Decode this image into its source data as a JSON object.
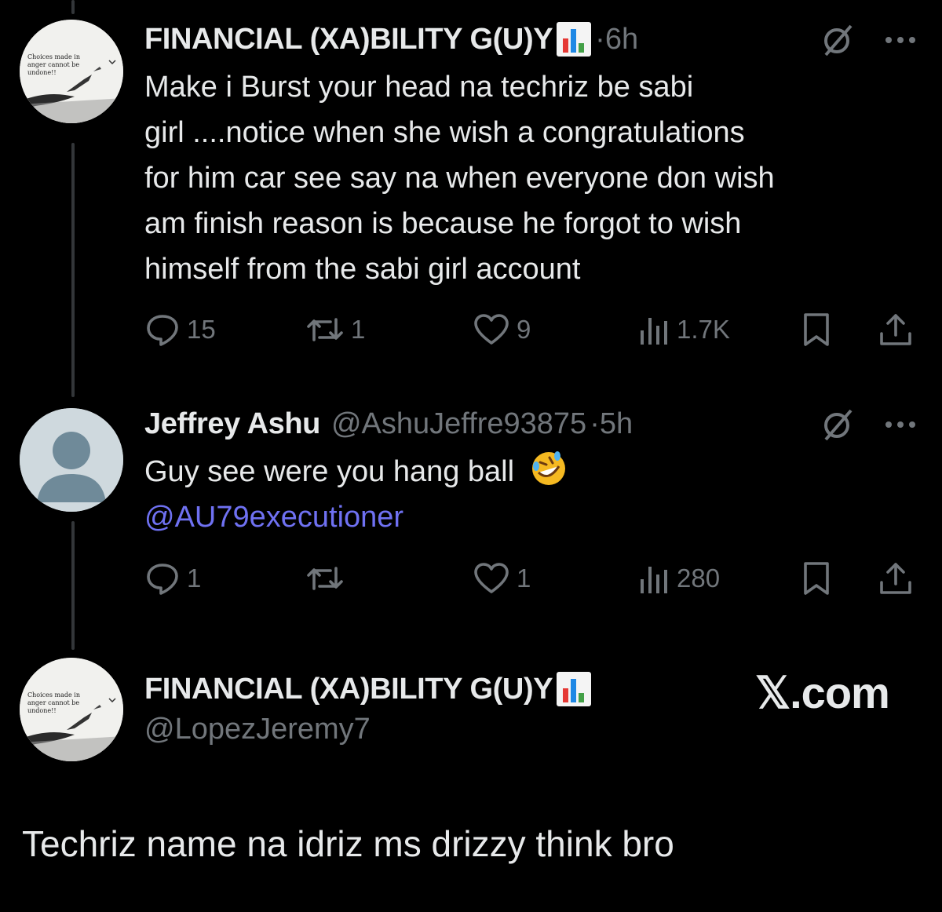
{
  "tweets": [
    {
      "display_name": "FINANCIAL (XA)BILITY G(U)Y",
      "time": "·6h",
      "lines": [
        "Make i Burst your head na techriz be sabi",
        "girl ....notice when she wish a congratulations",
        "for him car see say na when everyone don wish",
        "am finish reason is because he forgot to wish",
        "himself from the sabi girl account"
      ],
      "replies": "15",
      "reposts": "1",
      "likes": "9",
      "views": "1.7K",
      "avatar_text": [
        "Choices made in",
        "anger cannot be",
        "undone!!"
      ]
    },
    {
      "display_name": "Jeffrey Ashu",
      "handle": "@AshuJeffre93875",
      "time": "·5h",
      "line1": "Guy see were you hang ball",
      "mention": "@AU79executioner",
      "replies": "1",
      "reposts": "",
      "likes": "1",
      "views": "280"
    }
  ],
  "quoted_author": {
    "display_name": "FINANCIAL (XA)BILITY G(U)Y",
    "handle": "@LopezJeremy7"
  },
  "brand": "𝕏.com",
  "caption": "Techriz name na idriz ms drizzy think bro",
  "colors": {
    "text": "#e7e9ea",
    "muted": "#71767b",
    "mention": "#6f71f2",
    "background": "#000000"
  }
}
